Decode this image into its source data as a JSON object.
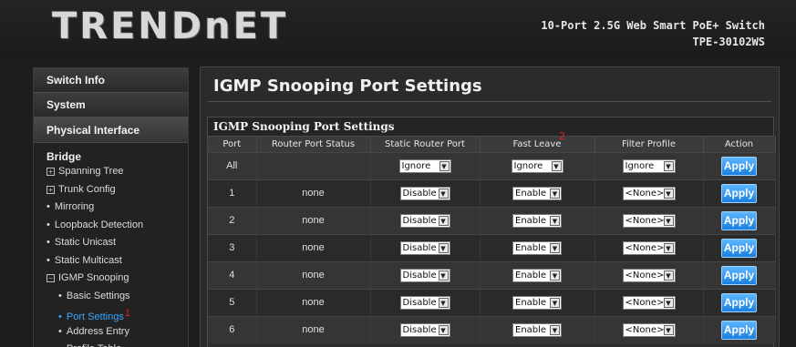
{
  "header": {
    "logo": "TRENDnET",
    "product_line1": "10-Port 2.5G Web Smart PoE+ Switch",
    "product_line2": "TPE-30102WS"
  },
  "sidebar": {
    "sections": [
      "Switch Info",
      "System",
      "Physical Interface"
    ],
    "bridge_title": "Bridge",
    "items": [
      {
        "label": "Spanning Tree",
        "icon": "plus-box-icon",
        "glyph": "+"
      },
      {
        "label": "Trunk Config",
        "icon": "plus-box-icon",
        "glyph": "+"
      },
      {
        "label": "Mirroring",
        "icon": "bullet",
        "glyph": "•"
      },
      {
        "label": "Loopback Detection",
        "icon": "bullet",
        "glyph": "•"
      },
      {
        "label": "Static Unicast",
        "icon": "bullet",
        "glyph": "•"
      },
      {
        "label": "Static Multicast",
        "icon": "bullet",
        "glyph": "•"
      },
      {
        "label": "IGMP Snooping",
        "icon": "minus-box-icon",
        "glyph": "−"
      }
    ],
    "subitems": [
      {
        "label": "Basic Settings",
        "glyph": "•"
      },
      {
        "label": "Port Settings",
        "glyph": "•",
        "active": true
      },
      {
        "label": "Address Entry",
        "glyph": "•"
      },
      {
        "label": "Profile Table",
        "glyph": "•"
      }
    ],
    "marker": "1"
  },
  "main": {
    "title": "IGMP Snooping Port Settings",
    "panel_title": "IGMP Snooping Port Settings",
    "marker": "2",
    "columns": [
      "Port",
      "Router Port Status",
      "Static Router Port",
      "Fast Leave",
      "Filter Profile",
      "Action"
    ],
    "rows": [
      {
        "port": "All",
        "status": "",
        "static_router": "Ignore",
        "fast_leave": "Ignore",
        "filter": "Ignore",
        "action": "Apply"
      },
      {
        "port": "1",
        "status": "none",
        "static_router": "Disable",
        "fast_leave": "Enable",
        "filter": "<None>",
        "action": "Apply"
      },
      {
        "port": "2",
        "status": "none",
        "static_router": "Disable",
        "fast_leave": "Enable",
        "filter": "<None>",
        "action": "Apply"
      },
      {
        "port": "3",
        "status": "none",
        "static_router": "Disable",
        "fast_leave": "Enable",
        "filter": "<None>",
        "action": "Apply"
      },
      {
        "port": "4",
        "status": "none",
        "static_router": "Disable",
        "fast_leave": "Enable",
        "filter": "<None>",
        "action": "Apply"
      },
      {
        "port": "5",
        "status": "none",
        "static_router": "Disable",
        "fast_leave": "Enable",
        "filter": "<None>",
        "action": "Apply"
      },
      {
        "port": "6",
        "status": "none",
        "static_router": "Disable",
        "fast_leave": "Enable",
        "filter": "<None>",
        "action": "Apply"
      }
    ]
  },
  "colors": {
    "accent": "#38a7ff",
    "button": "#1a7fe0",
    "marker": "#e02020"
  }
}
